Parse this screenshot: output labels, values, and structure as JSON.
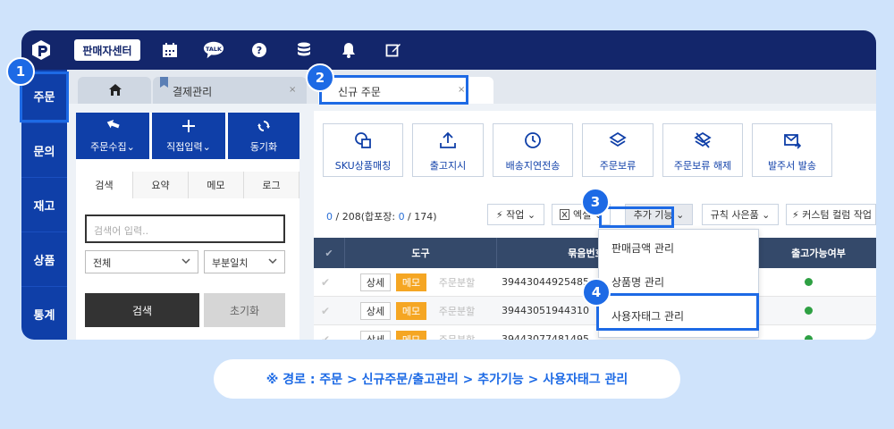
{
  "topbar": {
    "seller_center": "판매자센터",
    "icons": [
      "logo-icon",
      "calendar-icon",
      "talk-icon",
      "help-icon",
      "database-icon",
      "bell-icon",
      "edit-icon"
    ],
    "talk_text": "TALK",
    "help_text": "?"
  },
  "sidenav": {
    "items": [
      {
        "label": "주문"
      },
      {
        "label": "문의"
      },
      {
        "label": "재고"
      },
      {
        "label": "상품"
      },
      {
        "label": "통계"
      }
    ]
  },
  "tabs": [
    {
      "label": ""
    },
    {
      "label": "결제관리",
      "close": "×"
    },
    {
      "label": "신규 주문",
      "close": "×"
    }
  ],
  "left_panel": {
    "actions": [
      {
        "label": "주문수집⌄"
      },
      {
        "label": "직접입력⌄"
      },
      {
        "label": "동기화"
      }
    ],
    "subtabs": [
      "검색",
      "요약",
      "메모",
      "로그"
    ],
    "search_placeholder": "검색어 입력..",
    "select_scope": "전체",
    "select_match": "부분일치",
    "search_button": "검색",
    "reset_button": "초기화"
  },
  "tools": [
    {
      "label": "SKU상품매칭"
    },
    {
      "label": "출고지시"
    },
    {
      "label": "배송지연전송"
    },
    {
      "label": "주문보류"
    },
    {
      "label": "주문보류 해제"
    },
    {
      "label": "발주서 발송"
    }
  ],
  "filter_bar": {
    "count_selected": "0",
    "count_text": " / 208(합포장: ",
    "count_merge": "0",
    "count_total": " / 174)",
    "buttons": [
      {
        "label": "⚡ 작업 ⌄"
      },
      {
        "label": "엑셀 ⌄"
      },
      {
        "label": "추가 기능 ⌄"
      },
      {
        "label": "규칙 사은품 ⌄"
      },
      {
        "label": "⚡ 커스텀 컬럼 작업 ⌄"
      }
    ]
  },
  "table": {
    "headers": [
      "✔",
      "도구",
      "묶음번호",
      "출고가능여부"
    ],
    "rows": [
      {
        "detail": "상세",
        "memo": "메모",
        "split": "주문분할",
        "bundle": "39443044925485"
      },
      {
        "detail": "상세",
        "memo": "메모",
        "split": "주문분할",
        "bundle": "39443051944310"
      },
      {
        "detail": "상세",
        "memo": "메모",
        "split": "주문분할",
        "bundle": "39443077481495"
      }
    ]
  },
  "dropdown": {
    "items": [
      "판매금액 관리",
      "상품명 관리",
      "사용자태그 관리"
    ]
  },
  "steps": [
    "1",
    "2",
    "3",
    "4"
  ],
  "caption": "※ 경로 : 주문 > 신규주문/출고관리 > 추가기능 > 사용자태그 관리",
  "colors": {
    "navy": "#13266b",
    "primary": "#0f3fa8",
    "highlight": "#1d6ae5",
    "memo": "#f5a623",
    "ok": "#2ea043"
  }
}
